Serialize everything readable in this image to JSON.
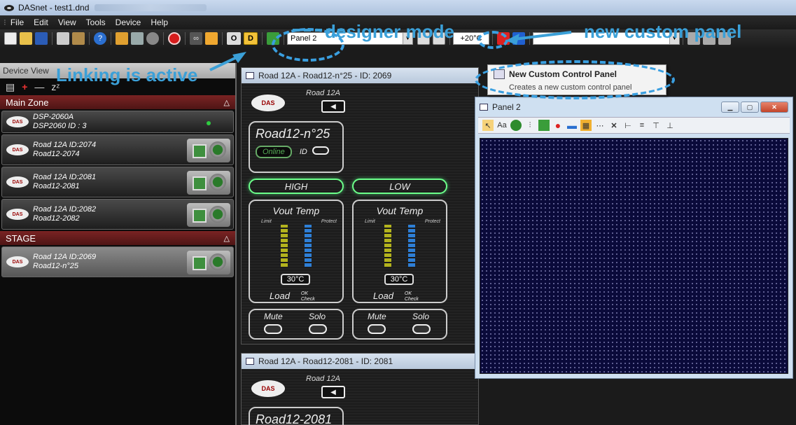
{
  "window": {
    "title": "DASnet - test1.dnd"
  },
  "menu": [
    "File",
    "Edit",
    "View",
    "Tools",
    "Device",
    "Help"
  ],
  "toolbar": {
    "mode_o": "O",
    "mode_d": "D",
    "panel_select": "Panel 2",
    "temp_value": "+20°C"
  },
  "annotations": {
    "designer_mode": "designer mode",
    "new_custom_panel": "new custom panel",
    "linking_active": "Linking is active"
  },
  "device_view": {
    "title": "Device View",
    "zones": [
      {
        "name": "Main Zone",
        "devices": [
          {
            "line1": "DSP-2060A",
            "line2": "DSP2060 ID : 3",
            "badge": "DAS",
            "short": true
          },
          {
            "line1": "Road 12A  ID:2074",
            "line2": "Road12-2074",
            "badge": "DAS"
          },
          {
            "line1": "Road 12A  ID:2081",
            "line2": "Road12-2081",
            "badge": "DAS"
          },
          {
            "line1": "Road 12A  ID:2082",
            "line2": "Road12-2082",
            "badge": "DAS"
          }
        ]
      },
      {
        "name": "STAGE",
        "devices": [
          {
            "line1": "Road 12A  ID:2069",
            "line2": "Road12-n°25",
            "badge": "DAS",
            "selected": true
          }
        ]
      }
    ]
  },
  "road_windows": [
    {
      "title": "Road 12A - Road12-n°25 - ID: 2069",
      "model": "Road 12A",
      "name": "Road12-n°25",
      "online": "Online",
      "id_label": "ID",
      "bands": [
        "HIGH",
        "LOW"
      ],
      "meter_title": "Vout  Temp",
      "limit": "Limit",
      "protect": "Protect",
      "temp": "30°C",
      "load": "Load",
      "ok": "OK",
      "check": "Check",
      "mute": "Mute",
      "solo": "Solo"
    },
    {
      "title": "Road 12A - Road12-2081 - ID: 2081",
      "model": "Road 12A",
      "name": "Road12-2081"
    }
  ],
  "dropdown": {
    "title": "New Custom Control Panel",
    "desc": "Creates a new custom control panel"
  },
  "panel2": {
    "title": "Panel 2",
    "text_tool": "Aa"
  }
}
